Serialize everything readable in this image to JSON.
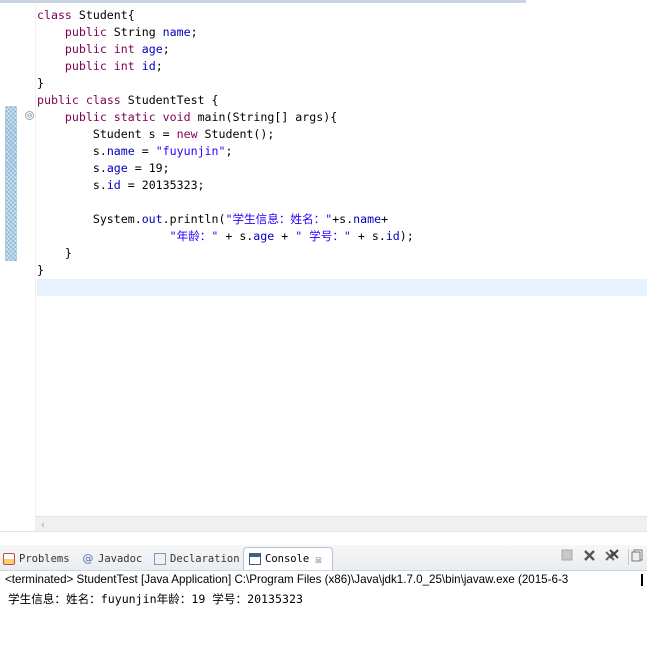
{
  "editor": {
    "lines": [
      [
        {
          "t": "class",
          "c": "kw"
        },
        {
          "t": " Student{",
          "c": ""
        }
      ],
      [
        {
          "t": "    ",
          "c": ""
        },
        {
          "t": "public",
          "c": "kw"
        },
        {
          "t": " String ",
          "c": ""
        },
        {
          "t": "name",
          "c": "fld"
        },
        {
          "t": ";",
          "c": ""
        }
      ],
      [
        {
          "t": "    ",
          "c": ""
        },
        {
          "t": "public",
          "c": "kw"
        },
        {
          "t": " ",
          "c": ""
        },
        {
          "t": "int",
          "c": "kw"
        },
        {
          "t": " ",
          "c": ""
        },
        {
          "t": "age",
          "c": "fld"
        },
        {
          "t": ";",
          "c": ""
        }
      ],
      [
        {
          "t": "    ",
          "c": ""
        },
        {
          "t": "public",
          "c": "kw"
        },
        {
          "t": " ",
          "c": ""
        },
        {
          "t": "int",
          "c": "kw"
        },
        {
          "t": " ",
          "c": ""
        },
        {
          "t": "id",
          "c": "fld"
        },
        {
          "t": ";",
          "c": ""
        }
      ],
      [
        {
          "t": "}",
          "c": ""
        }
      ],
      [
        {
          "t": "public",
          "c": "kw"
        },
        {
          "t": " ",
          "c": ""
        },
        {
          "t": "class",
          "c": "kw"
        },
        {
          "t": " StudentTest {",
          "c": ""
        }
      ],
      [
        {
          "t": "    ",
          "c": ""
        },
        {
          "t": "public",
          "c": "kw"
        },
        {
          "t": " ",
          "c": ""
        },
        {
          "t": "static",
          "c": "kw"
        },
        {
          "t": " ",
          "c": ""
        },
        {
          "t": "void",
          "c": "kw"
        },
        {
          "t": " main(String[] args){",
          "c": ""
        }
      ],
      [
        {
          "t": "        Student s = ",
          "c": ""
        },
        {
          "t": "new",
          "c": "kw"
        },
        {
          "t": " Student();",
          "c": ""
        }
      ],
      [
        {
          "t": "        s.",
          "c": ""
        },
        {
          "t": "name",
          "c": "fld"
        },
        {
          "t": " = ",
          "c": ""
        },
        {
          "t": "\"fuyunjin\"",
          "c": "str"
        },
        {
          "t": ";",
          "c": ""
        }
      ],
      [
        {
          "t": "        s.",
          "c": ""
        },
        {
          "t": "age",
          "c": "fld"
        },
        {
          "t": " = 19;",
          "c": ""
        }
      ],
      [
        {
          "t": "        s.",
          "c": ""
        },
        {
          "t": "id",
          "c": "fld"
        },
        {
          "t": " = 20135323;",
          "c": ""
        }
      ],
      [
        {
          "t": "",
          "c": ""
        }
      ],
      [
        {
          "t": "        System.",
          "c": ""
        },
        {
          "t": "out",
          "c": "fld"
        },
        {
          "t": ".println(",
          "c": ""
        },
        {
          "t": "\"学生信息：姓名：\"",
          "c": "str"
        },
        {
          "t": "+s.",
          "c": ""
        },
        {
          "t": "name",
          "c": "fld"
        },
        {
          "t": "+",
          "c": ""
        }
      ],
      [
        {
          "t": "                   ",
          "c": ""
        },
        {
          "t": "\"年龄：\"",
          "c": "str"
        },
        {
          "t": " + s.",
          "c": ""
        },
        {
          "t": "age",
          "c": "fld"
        },
        {
          "t": " + ",
          "c": ""
        },
        {
          "t": "\" 学号：\"",
          "c": "str"
        },
        {
          "t": " + s.",
          "c": ""
        },
        {
          "t": "id",
          "c": "fld"
        },
        {
          "t": ");",
          "c": ""
        }
      ],
      [
        {
          "t": "    }",
          "c": ""
        }
      ],
      [
        {
          "t": "}",
          "c": ""
        }
      ],
      [
        {
          "t": "",
          "c": ""
        }
      ]
    ],
    "current_line_index": 16,
    "fold_symbol": "⊖"
  },
  "panel": {
    "tabs": [
      {
        "label": "Problems",
        "icon": "problems-icon"
      },
      {
        "label": "Javadoc",
        "icon": "javadoc-icon"
      },
      {
        "label": "Declaration",
        "icon": "declaration-icon"
      },
      {
        "label": "Console",
        "icon": "console-icon",
        "active": true
      }
    ],
    "close_symbol": "☒",
    "console_header": "<terminated> StudentTest [Java Application] C:\\Program Files (x86)\\Java\\jdk1.7.0_25\\bin\\javaw.exe (2015-6-3",
    "console_output": "学生信息：姓名：fuyunjin年龄：19 学号：20135323"
  },
  "colors": {
    "keyword": "#7f0055",
    "field": "#0000c0",
    "string": "#2a00ff",
    "current_line": "#e8f2fe",
    "change_bar": "#8fbbd8"
  }
}
